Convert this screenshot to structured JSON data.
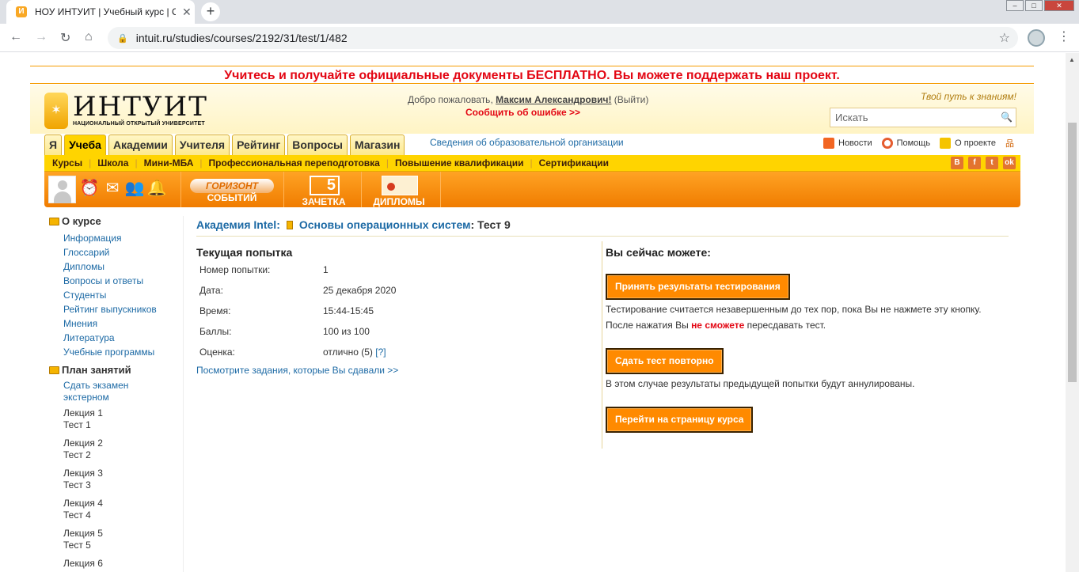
{
  "browser": {
    "tab_title": "НОУ ИНТУИТ | Учебный курс | С",
    "url": "intuit.ru/studies/courses/2192/31/test/1/482"
  },
  "banner": "Учитесь и получайте официальные документы БЕСПЛАТНО. Вы можете поддержать наш проект.",
  "header": {
    "logo_text": "ИНТУИТ",
    "logo_sub": "НАЦИОНАЛЬНЫЙ ОТКРЫТЫЙ УНИВЕРСИТЕТ",
    "welcome_prefix": "Добро пожаловать,",
    "user_name": "Максим Александрович!",
    "logout": "(Выйти)",
    "report_error": "Сообщить об ошибке >>",
    "slogan": "Твой путь к знаниям!",
    "search_placeholder": "Искать"
  },
  "tabs": [
    {
      "label": "Я"
    },
    {
      "label": "Учеба"
    },
    {
      "label": "Академии"
    },
    {
      "label": "Учителя"
    },
    {
      "label": "Рейтинг"
    },
    {
      "label": "Вопросы"
    },
    {
      "label": "Магазин"
    }
  ],
  "org_link": "Сведения об образовательной организации",
  "right_links": {
    "news": "Новости",
    "help": "Помощь",
    "about": "О проекте"
  },
  "study_menu": [
    "Курсы",
    "Школа",
    "Мини-МБА",
    "Профессиональная переподготовка",
    "Повышение квалификации",
    "Сертификации"
  ],
  "social": [
    "В",
    "f",
    "t",
    "ok"
  ],
  "orange_bar": {
    "horizon_btn": "ГОРИЗОНТ",
    "horizon_label": "СОБЫТИЙ",
    "gradebook_num": "5",
    "gradebook_label": "ЗАЧЕТКА",
    "diplomas_label": "ДИПЛОМЫ"
  },
  "sidebar": {
    "about_title": "О курсе",
    "about_links": [
      "Информация",
      "Глоссарий",
      "Дипломы",
      "Вопросы и ответы",
      "Студенты",
      "Рейтинг выпускников",
      "Мнения",
      "Литература",
      "Учебные программы"
    ],
    "plan_title": "План занятий",
    "exam_link_1": "Сдать экзамен",
    "exam_link_2": "экстерном",
    "lectures": [
      {
        "lecture": "Лекция 1",
        "test": "Тест 1"
      },
      {
        "lecture": "Лекция 2",
        "test": "Тест 2"
      },
      {
        "lecture": "Лекция 3",
        "test": "Тест 3"
      },
      {
        "lecture": "Лекция 4",
        "test": "Тест 4"
      },
      {
        "lecture": "Лекция 5",
        "test": "Тест 5"
      },
      {
        "lecture": "Лекция 6",
        "test": ""
      }
    ]
  },
  "breadcrumbs": {
    "academy": "Академия Intel:",
    "course": "Основы операционных систем",
    "current": ": Тест 9"
  },
  "attempt": {
    "title": "Текущая попытка",
    "rows": [
      {
        "label": "Номер попытки:",
        "value": "1"
      },
      {
        "label": "Дата:",
        "value": "25 декабря 2020"
      },
      {
        "label": "Время:",
        "value": "15:44-15:45"
      },
      {
        "label": "Баллы:",
        "value": "100 из 100"
      },
      {
        "label": "Оценка:",
        "value": "отлично (5)",
        "help": "[?]"
      }
    ],
    "review_link": "Посмотрите задания, которые Вы сдавали >>"
  },
  "actions": {
    "title": "Вы сейчас можете:",
    "accept_button": "Принять результаты тестирования",
    "accept_note_1": "Тестирование считается незавершенным до тех пор, пока Вы не нажмете эту кнопку.",
    "accept_note_2_prefix": "После нажатия Вы",
    "accept_note_2_bold": "не сможете",
    "accept_note_2_suffix": "пересдавать тест.",
    "retake_button": "Сдать тест повторно",
    "retake_note": "В этом случае результаты предыдущей попытки будут аннулированы.",
    "course_button": "Перейти на страницу курса"
  },
  "colors": {
    "brand_orange": "#f07c00",
    "brand_yellow": "#ffd400",
    "alert_red": "#e30613",
    "link_blue": "#1d6aa5"
  }
}
